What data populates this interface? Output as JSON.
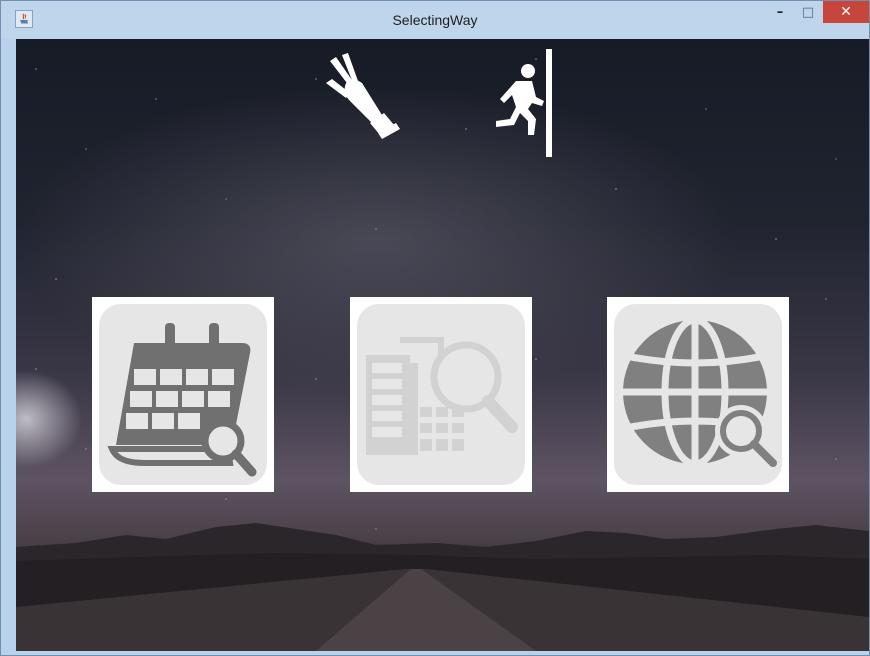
{
  "window": {
    "title": "SelectingWay",
    "minimize_symbol": "–",
    "maximize_symbol": "□",
    "close_symbol": "✕",
    "close_color": "#c7463b"
  },
  "toolbar": {
    "icons": [
      "hand-gesture-icon",
      "exit-door-icon"
    ]
  },
  "options": [
    {
      "icon": "calendar-search-icon",
      "state": "enabled"
    },
    {
      "icon": "building-search-icon",
      "state": "disabled"
    },
    {
      "icon": "globe-search-icon",
      "state": "enabled"
    }
  ],
  "colors": {
    "icon_dark": "#707070",
    "icon_disabled": "#d2d2d2",
    "tile_background": "#e6e6e6",
    "top_icons": "#ffffff"
  }
}
